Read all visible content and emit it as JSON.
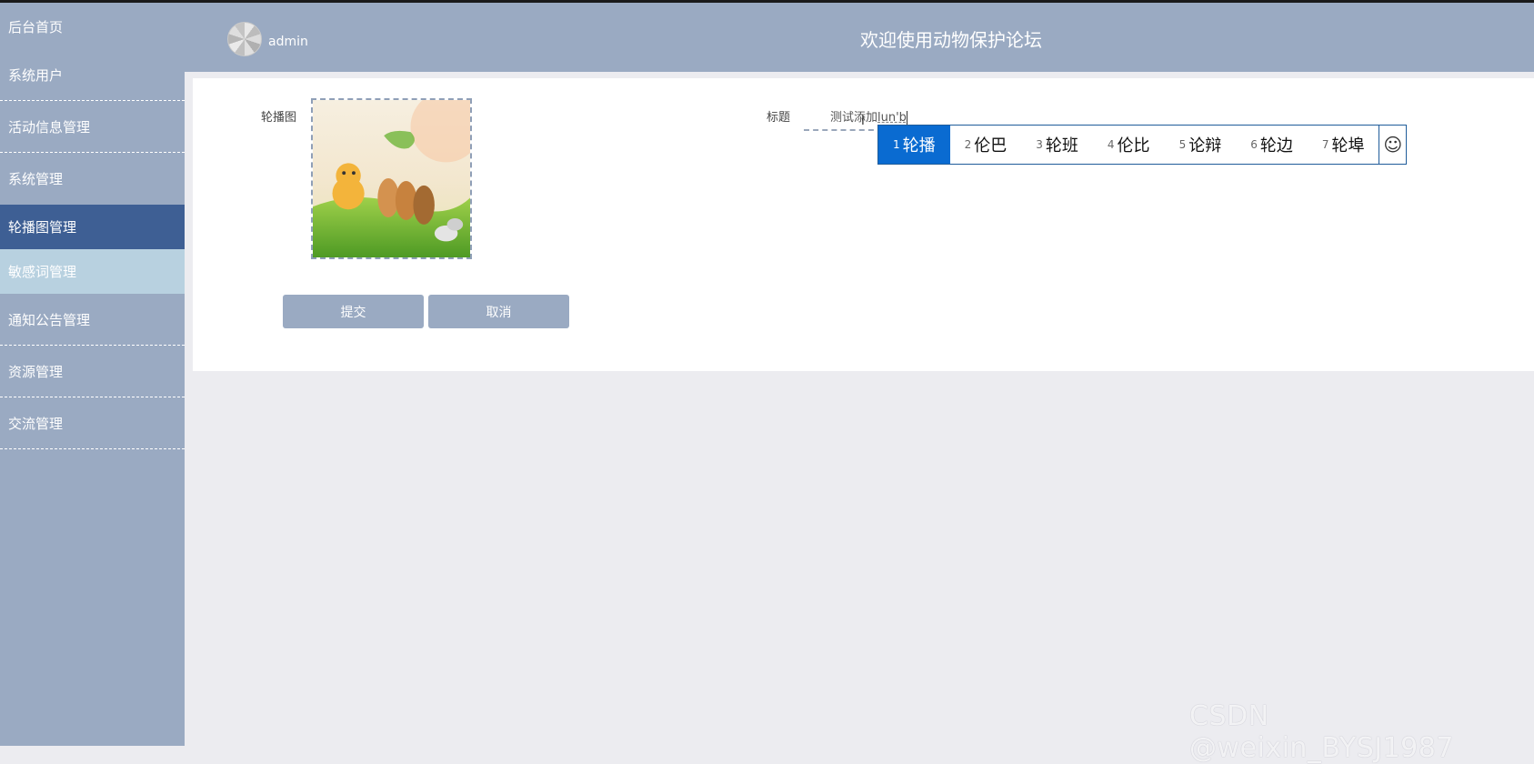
{
  "sidebar": {
    "items": [
      {
        "label": "后台首页"
      },
      {
        "label": "系统用户"
      },
      {
        "label": "活动信息管理"
      },
      {
        "label": "系统管理"
      },
      {
        "label": "轮播图管理"
      },
      {
        "label": "敏感词管理"
      },
      {
        "label": "通知公告管理"
      },
      {
        "label": "资源管理"
      },
      {
        "label": "交流管理"
      }
    ]
  },
  "header": {
    "username": "admin",
    "site_title": "欢迎使用动物保护论坛"
  },
  "form": {
    "image_label": "轮播图",
    "title_label": "标题",
    "title_text": "测试添加",
    "title_composition": "lun'b",
    "submit_label": "提交",
    "cancel_label": "取消"
  },
  "ime": {
    "candidates": [
      {
        "num": "1",
        "text": "轮播"
      },
      {
        "num": "2",
        "text": "伦巴"
      },
      {
        "num": "3",
        "text": "轮班"
      },
      {
        "num": "4",
        "text": "伦比"
      },
      {
        "num": "5",
        "text": "论辩"
      },
      {
        "num": "6",
        "text": "轮边"
      },
      {
        "num": "7",
        "text": "轮埠"
      }
    ],
    "emoji_icon": "☺"
  },
  "watermark": "CSDN @weixin_BYSJ1987",
  "colors": {
    "sidebar_bg": "#9aaac2",
    "sidebar_active": "#3e5f94",
    "sidebar_hover": "#b8d1e0",
    "ime_selected": "#0a6bd1",
    "button_bg": "#9aaac2"
  }
}
